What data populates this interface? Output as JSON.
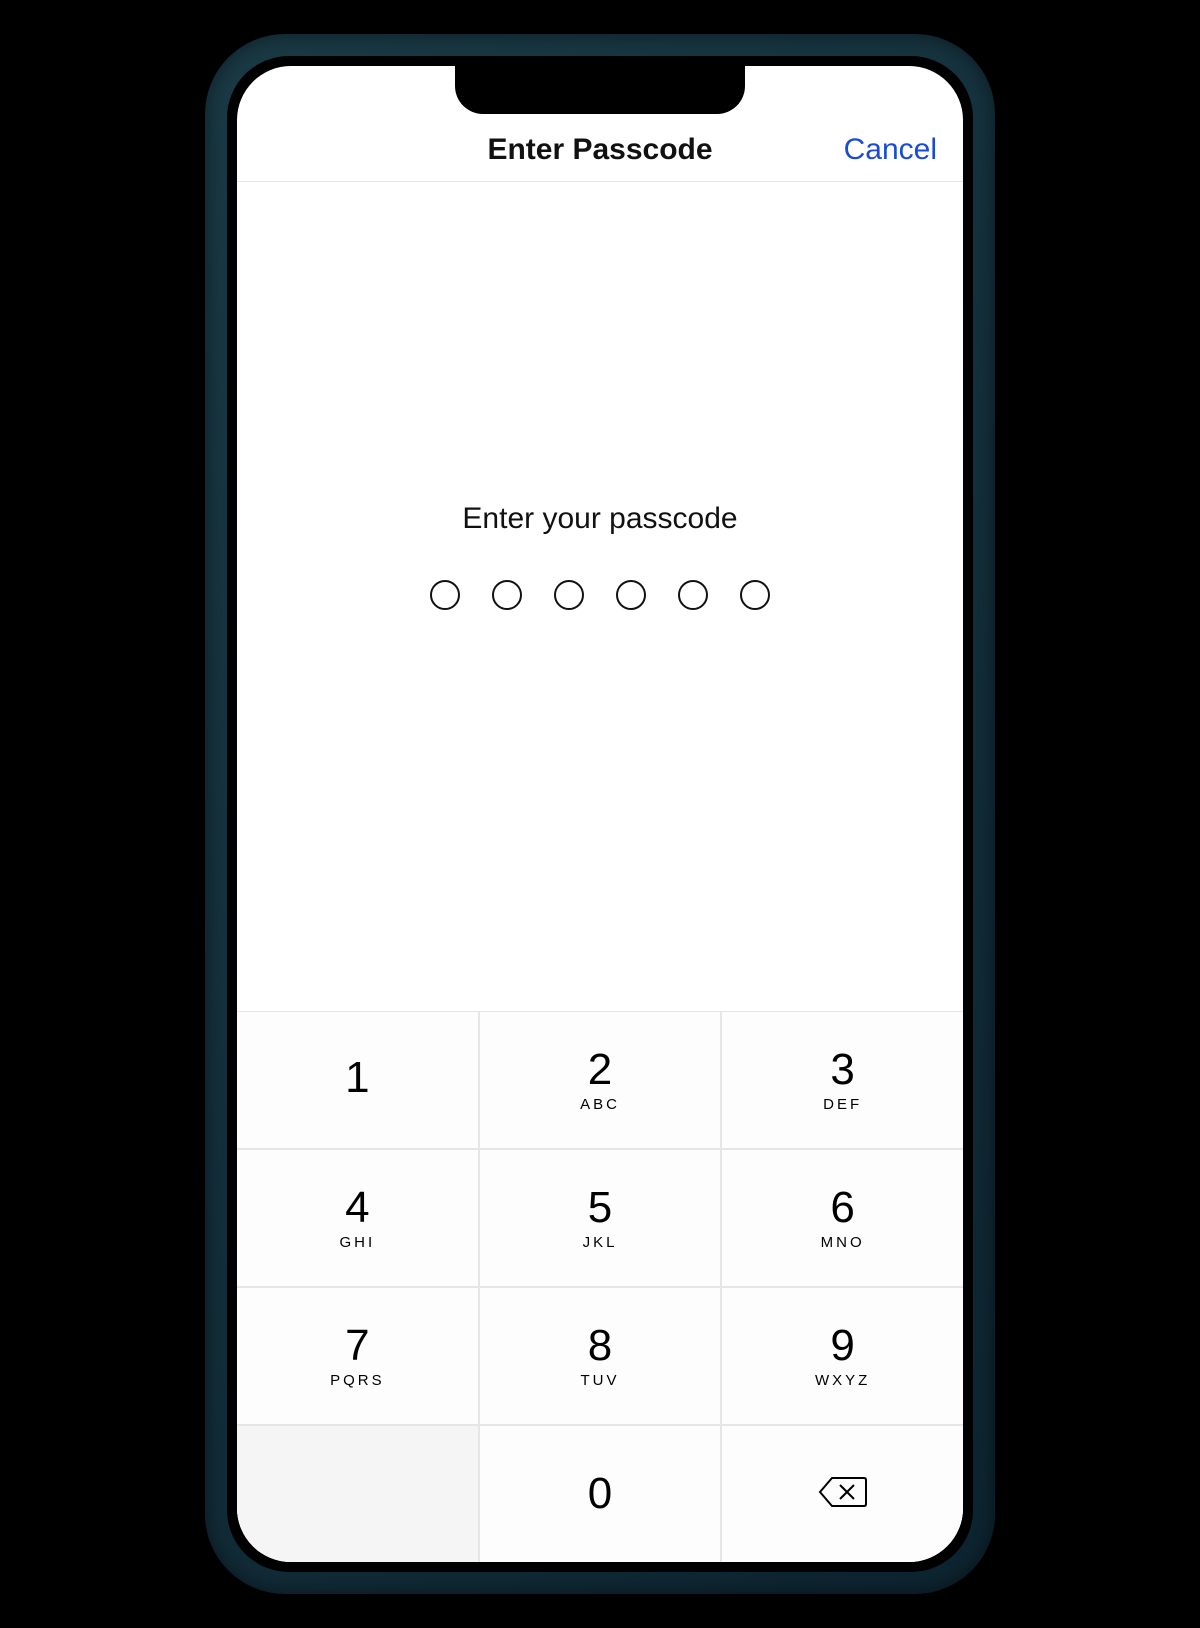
{
  "header": {
    "title": "Enter Passcode",
    "cancel": "Cancel"
  },
  "prompt": "Enter your passcode",
  "pin_length": 6,
  "colors": {
    "link": "#1a4bd6"
  },
  "keypad": [
    {
      "digit": "1",
      "letters": " "
    },
    {
      "digit": "2",
      "letters": "ABC"
    },
    {
      "digit": "3",
      "letters": "DEF"
    },
    {
      "digit": "4",
      "letters": "GHI"
    },
    {
      "digit": "5",
      "letters": "JKL"
    },
    {
      "digit": "6",
      "letters": "MNO"
    },
    {
      "digit": "7",
      "letters": "PQRS"
    },
    {
      "digit": "8",
      "letters": "TUV"
    },
    {
      "digit": "9",
      "letters": "WXYZ"
    },
    {
      "digit": "0",
      "letters": ""
    }
  ]
}
